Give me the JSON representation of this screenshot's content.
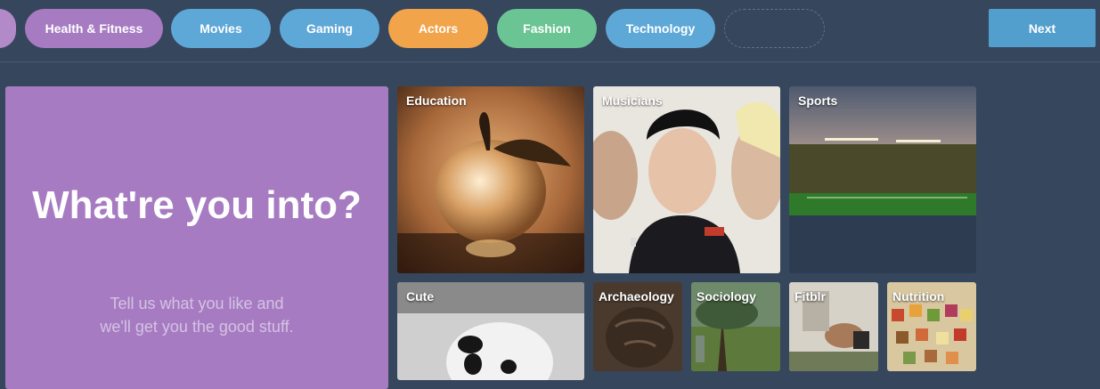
{
  "topbar": {
    "pills": [
      {
        "label": "",
        "color": "#b38ac8"
      },
      {
        "label": "Health & Fitness",
        "color": "#a67bc2"
      },
      {
        "label": "Movies",
        "color": "#5ea8d8"
      },
      {
        "label": "Gaming",
        "color": "#5ea8d8"
      },
      {
        "label": "Actors",
        "color": "#f2a44a"
      },
      {
        "label": "Fashion",
        "color": "#6bc494"
      },
      {
        "label": "Technology",
        "color": "#5ea8d8"
      }
    ],
    "next_label": "Next"
  },
  "hero": {
    "title": "What're you into?",
    "subtitle": "Tell us what you like and we'll get you the good stuff."
  },
  "tiles": [
    {
      "label": "Education"
    },
    {
      "label": "Musicians"
    },
    {
      "label": "Sports"
    },
    {
      "label": "Cute"
    },
    {
      "label": "Archaeology"
    },
    {
      "label": "Sociology"
    },
    {
      "label": "Fitblr"
    },
    {
      "label": "Nutrition"
    }
  ],
  "colors": {
    "background": "#36465d",
    "next_button": "#529ecc",
    "hero_background": "#a67bc2"
  }
}
